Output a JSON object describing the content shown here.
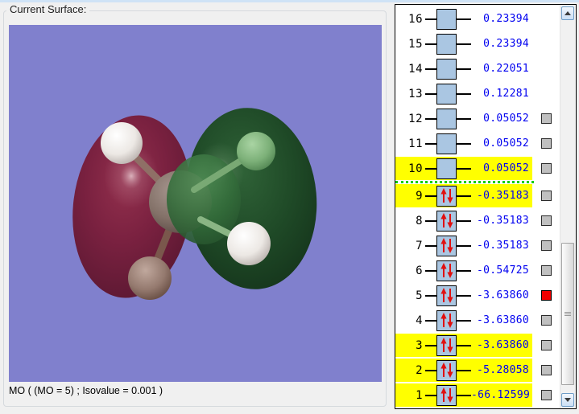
{
  "surface_panel": {
    "label": "Current Surface:",
    "caption": "MO ( (MO = 5) ; Isovalue = 0.001 )"
  },
  "viewport": {
    "background_color": "#8080cd",
    "negative_lobe_color": "#6e1b38",
    "positive_lobe_color": "#1c4424"
  },
  "mo_panel": {
    "divider_after": "10",
    "colors": {
      "orbital_box_fill": "#aac6e2",
      "energy_text": "#0000f0",
      "row_highlight": "#ffff00",
      "divider_green": "#00cf00",
      "spin_arrow_red": "#e01010",
      "checkbox_gray": "#c0c0c0",
      "checkbox_red": "#f00000"
    },
    "rows": [
      {
        "number": "16",
        "energy": "0.23394",
        "occupied": false,
        "highlighted": false,
        "checkbox": "none"
      },
      {
        "number": "15",
        "energy": "0.23394",
        "occupied": false,
        "highlighted": false,
        "checkbox": "none"
      },
      {
        "number": "14",
        "energy": "0.22051",
        "occupied": false,
        "highlighted": false,
        "checkbox": "none"
      },
      {
        "number": "13",
        "energy": "0.12281",
        "occupied": false,
        "highlighted": false,
        "checkbox": "none"
      },
      {
        "number": "12",
        "energy": "0.05052",
        "occupied": false,
        "highlighted": false,
        "checkbox": "gray"
      },
      {
        "number": "11",
        "energy": "0.05052",
        "occupied": false,
        "highlighted": false,
        "checkbox": "gray"
      },
      {
        "number": "10",
        "energy": "0.05052",
        "occupied": false,
        "highlighted": true,
        "checkbox": "gray"
      },
      {
        "number": "9",
        "energy": "-0.35183",
        "occupied": true,
        "highlighted": true,
        "checkbox": "gray"
      },
      {
        "number": "8",
        "energy": "-0.35183",
        "occupied": true,
        "highlighted": false,
        "checkbox": "gray"
      },
      {
        "number": "7",
        "energy": "-0.35183",
        "occupied": true,
        "highlighted": false,
        "checkbox": "gray"
      },
      {
        "number": "6",
        "energy": "-0.54725",
        "occupied": true,
        "highlighted": false,
        "checkbox": "gray"
      },
      {
        "number": "5",
        "energy": "-3.63860",
        "occupied": true,
        "highlighted": false,
        "checkbox": "red"
      },
      {
        "number": "4",
        "energy": "-3.63860",
        "occupied": true,
        "highlighted": false,
        "checkbox": "gray"
      },
      {
        "number": "3",
        "energy": "-3.63860",
        "occupied": true,
        "highlighted": true,
        "checkbox": "gray"
      },
      {
        "number": "2",
        "energy": "-5.28058",
        "occupied": true,
        "highlighted": true,
        "checkbox": "gray"
      },
      {
        "number": "1",
        "energy": "-66.12599",
        "occupied": true,
        "highlighted": true,
        "checkbox": "gray"
      }
    ]
  }
}
